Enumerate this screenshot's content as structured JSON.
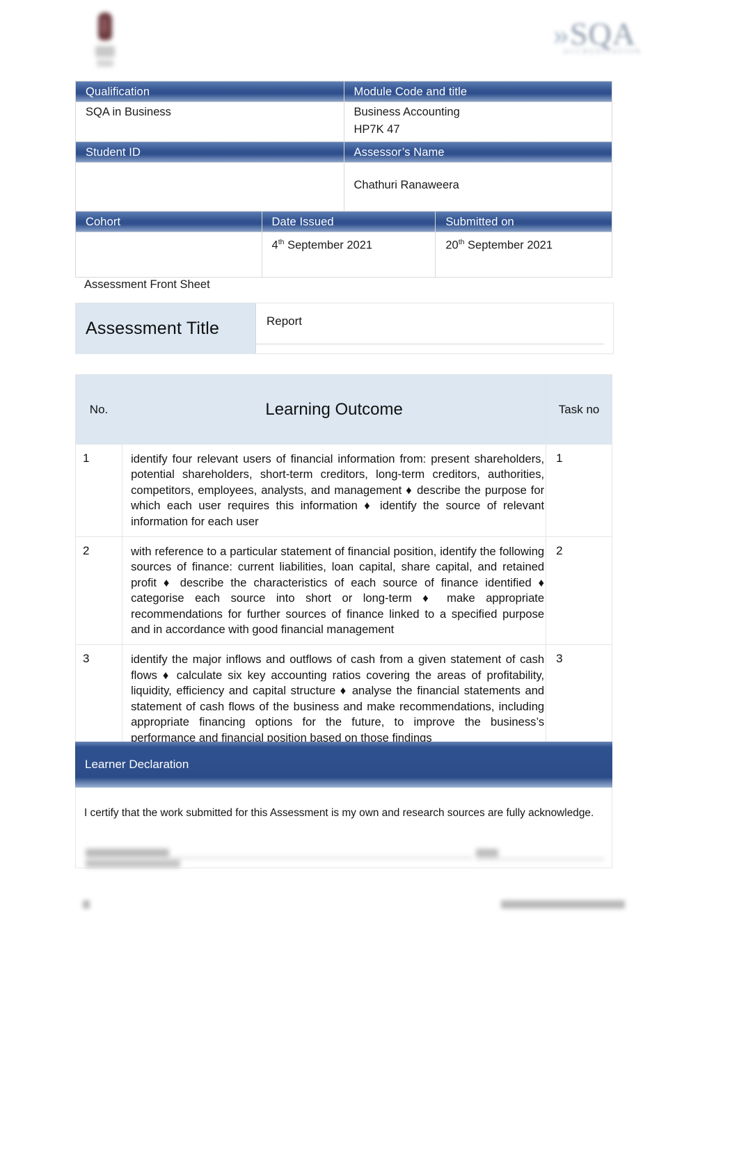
{
  "branding": {
    "crest_alt": "institution-crest",
    "sqa_logo_text": "SQA",
    "sqa_logo_mark": "»",
    "sqa_logo_sub": "ACCREDITATION"
  },
  "colors": {
    "header_blue": "#2f4f8d",
    "header_blue_light": "#5b7cb2",
    "panel_light_blue": "#dce7f1",
    "declaration_blue": "#2c4c88",
    "text": "#131313",
    "border": "#e1e5e9"
  },
  "info_table": {
    "rows": [
      {
        "left_header": "Qualification",
        "left_value": "SQA in Business",
        "right_header": "Module Code and title",
        "right_value_line1": "Business Accounting",
        "right_value_line2": "HP7K 47"
      },
      {
        "left_header": "Student ID",
        "left_value": "",
        "right_header": "Assessor’s Name",
        "right_value_line1": "Chathuri Ranaweera",
        "right_value_line2": ""
      }
    ],
    "bottom_row": {
      "cohort_header": "Cohort",
      "cohort_value": "",
      "date_issued_header": "Date Issued",
      "date_issued_day": "4",
      "date_issued_suffix": "th",
      "date_issued_rest": " September 2021",
      "submitted_header": "Submitted on",
      "submitted_day": "20",
      "submitted_suffix": "th",
      "submitted_rest": " September 2021"
    }
  },
  "front_sheet_caption": "Assessment Front Sheet",
  "assessment_title": {
    "label": "Assessment Title",
    "value": "Report"
  },
  "learning_outcomes": {
    "columns": {
      "no": "No.",
      "outcome": "Learning Outcome",
      "task": "Task no"
    },
    "rows": [
      {
        "no": "1",
        "task": "1",
        "text": "identify four relevant users of financial information from: present shareholders, potential shareholders, short-term creditors, long-term creditors, authorities, competitors, employees, analysts, and management ♦ describe the purpose for which each user requires this information ♦ identify the source of relevant information for each user"
      },
      {
        "no": "2",
        "task": "2",
        "text": " with reference to a particular statement of financial position, identify the following sources of finance: current liabilities, loan capital, share capital, and retained profit ♦ describe the characteristics of each source of finance identified ♦ categorise each source into short or long-term ♦ make appropriate recommendations for further sources of finance linked to a specified purpose and in accordance with good financial management"
      },
      {
        "no": "3",
        "task": "3",
        "text": " identify the major inflows and outflows of cash from a given statement of cash flows ♦ calculate six key accounting ratios covering the areas of profitability, liquidity, efficiency and capital structure ♦ analyse the financial statements and statement of cash flows of the business and make recommendations, including appropriate financing options for the future, to improve the business’s performance and financial position based on those findings"
      }
    ]
  },
  "learner_declaration": {
    "heading": "Learner Declaration",
    "statement": "I certify that the work submitted for this Assessment is my own and research sources are fully acknowledge.",
    "signature_line_label": "",
    "date_label": ""
  },
  "footer": {
    "page_number": "",
    "reference": ""
  }
}
